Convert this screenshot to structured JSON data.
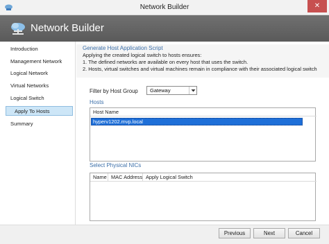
{
  "window": {
    "title": "Network Builder",
    "close_glyph": "✕",
    "app_icon": "network-cloud-icon"
  },
  "banner": {
    "title": "Network Builder",
    "icon": "network-cloud-icon"
  },
  "sidebar": {
    "items": [
      {
        "label": "Introduction"
      },
      {
        "label": "Management Network"
      },
      {
        "label": "Logical Network"
      },
      {
        "label": "Virtual Networks"
      },
      {
        "label": "Logical Switch"
      },
      {
        "label": "Apply To Hosts",
        "selected": true
      },
      {
        "label": "Summary"
      }
    ]
  },
  "main": {
    "heading": "Generate Host Application Script",
    "description": [
      "Applying the created logical switch to hosts ensures:",
      "1. The defined networks are available on every host that uses the switch.",
      "2. Hosts, virtual switches and virtual machines remain in compliance with their associated logical switch"
    ],
    "filter": {
      "label": "Filter by Host Group",
      "value": "Gateway"
    },
    "hosts": {
      "heading": "Hosts",
      "columns": [
        "Host Name"
      ],
      "rows": [
        {
          "host_name": "hyperv1202.mvp.local",
          "selected": true
        }
      ]
    },
    "nics": {
      "heading": "Select Physical NICs",
      "columns": [
        "Name",
        "MAC Address",
        "Apply Logical Switch"
      ],
      "rows": []
    }
  },
  "footer": {
    "previous_label": "Previous",
    "next_label": "Next",
    "cancel_label": "Cancel"
  },
  "colors": {
    "accent_heading": "#3a6ea8",
    "selection_blue": "#1e6fd8",
    "nav_selected_bg": "#cde6f7",
    "banner_bg": "#646464",
    "close_red": "#c75050"
  }
}
